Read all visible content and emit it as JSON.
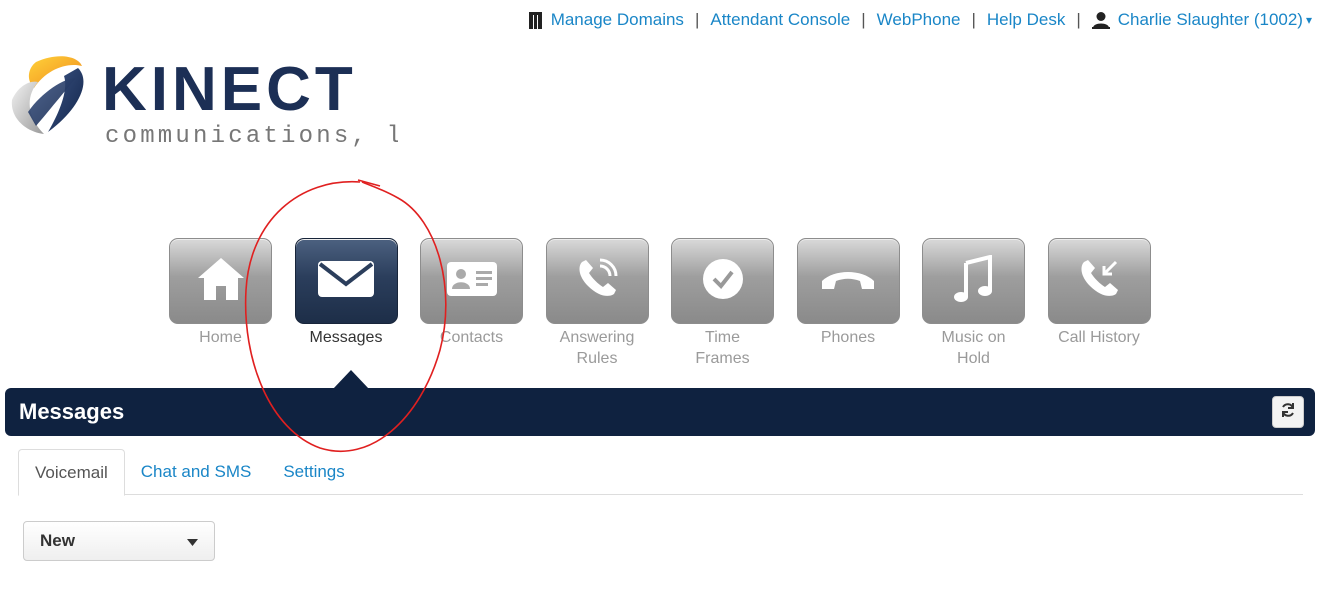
{
  "topbar": {
    "links": [
      "Manage Domains",
      "Attendant Console",
      "WebPhone",
      "Help Desk"
    ],
    "user": "Charlie Slaughter (1002)",
    "separator": "|",
    "caret": "▾"
  },
  "logo": {
    "word": "KINECT",
    "tagline": "communications, llc"
  },
  "nav": {
    "home": "Home",
    "messages": "Messages",
    "contacts": "Contacts",
    "answering_rules": [
      "Answering",
      "Rules"
    ],
    "time_frames": [
      "Time",
      "Frames"
    ],
    "phones": "Phones",
    "music_on_hold": [
      "Music on",
      "Hold"
    ],
    "call_history": "Call History",
    "active": "Messages"
  },
  "section": {
    "title": "Messages"
  },
  "tabs": {
    "voicemail": "Voicemail",
    "chat_sms": "Chat and SMS",
    "settings": "Settings",
    "active": "Voicemail"
  },
  "filter": {
    "selected": "New"
  },
  "colors": {
    "link": "#1a86c7",
    "navy": "#0f2240",
    "annotation": "#e02020"
  }
}
